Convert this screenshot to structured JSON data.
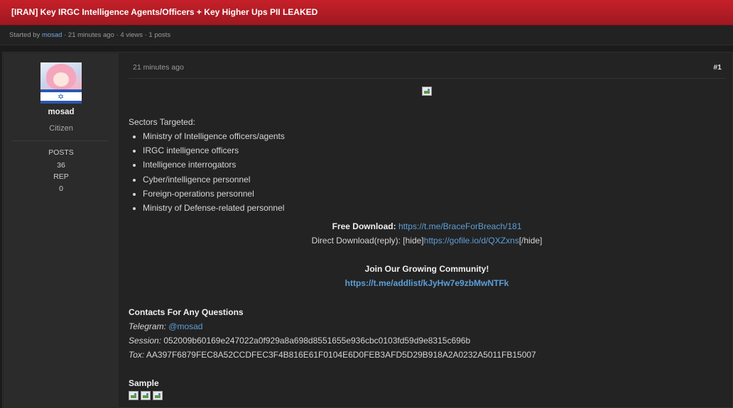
{
  "thread": {
    "title": "[IRAN] Key IRGC Intelligence Agents/Officers + Key Higher Ups PII LEAKED",
    "started_by_prefix": "Started by",
    "author": "mosad",
    "meta_suffix": "· 21 minutes ago · 4 views · 1 posts"
  },
  "user": {
    "username": "mosad",
    "usertitle": "Citizen",
    "posts_label": "POSTS",
    "posts_value": "36",
    "rep_label": "REP",
    "rep_value": "0"
  },
  "post": {
    "time": "21 minutes ago",
    "number": "#1",
    "sectors_heading": "Sectors Targeted:",
    "sectors": [
      "Ministry of Intelligence officers/agents",
      "IRGC intelligence officers",
      "Intelligence interrogators",
      "Cyber/intelligence personnel",
      "Foreign-operations personnel",
      "Ministry of Defense-related personnel"
    ],
    "free_download_label": "Free Download:",
    "free_download_link": "https://t.me/BraceForBreach/181",
    "direct_download_prefix": "Direct Download(reply): [hide]",
    "direct_download_link": "https://gofile.io/d/QXZxns",
    "direct_download_suffix": "[/hide]",
    "community_heading": "Join Our Growing Community!",
    "community_link": "https://t.me/addlist/kJyHw7e9zbMwNTFk",
    "contacts_heading": "Contacts For Any Questions",
    "telegram_label": "Telegram:",
    "telegram_handle": "@mosad",
    "session_label": "Session:",
    "session_value": "052009b60169e247022a0f929a8a698d8551655e936cbc0103fd59d9e8315c696b",
    "tox_label": "Tox:",
    "tox_value": "AA397F6879FEC8A52CCDFEC3F4B816E61F0104E6D0FEB3AFD5D29B918A2A0232A5011FB15007",
    "sample_heading": "Sample"
  },
  "colors": {
    "title_bar": "#b01c25",
    "link": "#5d9fd8",
    "background": "#1b1b1b"
  }
}
